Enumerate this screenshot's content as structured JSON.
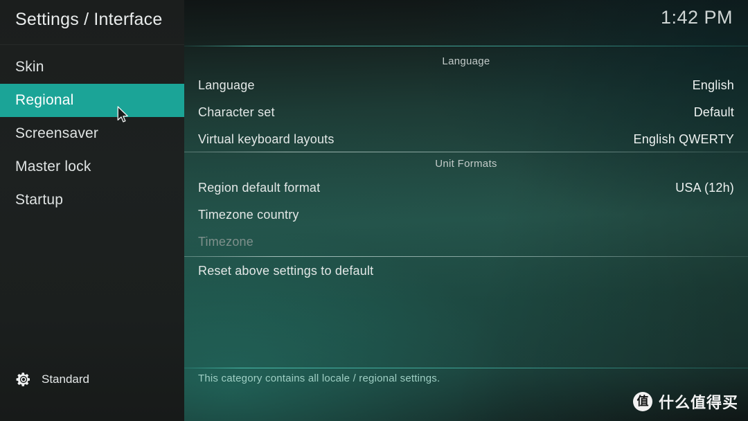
{
  "sidebar": {
    "title": "Settings / Interface",
    "items": [
      {
        "label": "Skin",
        "selected": false
      },
      {
        "label": "Regional",
        "selected": true
      },
      {
        "label": "Screensaver",
        "selected": false
      },
      {
        "label": "Master lock",
        "selected": false
      },
      {
        "label": "Startup",
        "selected": false
      }
    ],
    "profile": {
      "icon": "gear-icon",
      "label": "Standard"
    }
  },
  "header": {
    "clock": "1:42 PM"
  },
  "main": {
    "groups": [
      {
        "title": "Language",
        "rows": [
          {
            "label": "Language",
            "value": "English",
            "disabled": false
          },
          {
            "label": "Character set",
            "value": "Default",
            "disabled": false
          },
          {
            "label": "Virtual keyboard layouts",
            "value": "English QWERTY",
            "disabled": false
          }
        ]
      },
      {
        "title": "Unit Formats",
        "rows": [
          {
            "label": "Region default format",
            "value": "USA (12h)",
            "disabled": false
          },
          {
            "label": "Timezone country",
            "value": "",
            "disabled": false
          },
          {
            "label": "Timezone",
            "value": "",
            "disabled": true
          }
        ]
      }
    ],
    "reset_row": {
      "label": "Reset above settings to default",
      "value": ""
    },
    "help_text": "This category contains all locale / regional settings."
  },
  "watermark": {
    "badge": "值",
    "text": "什么值得买"
  },
  "colors": {
    "accent_teal": "#1ba497",
    "sidebar_bg": "#1c201f",
    "panel_green": "#26534a",
    "help_text": "#9fcfc4",
    "rule_teal": "#56d6c4"
  }
}
